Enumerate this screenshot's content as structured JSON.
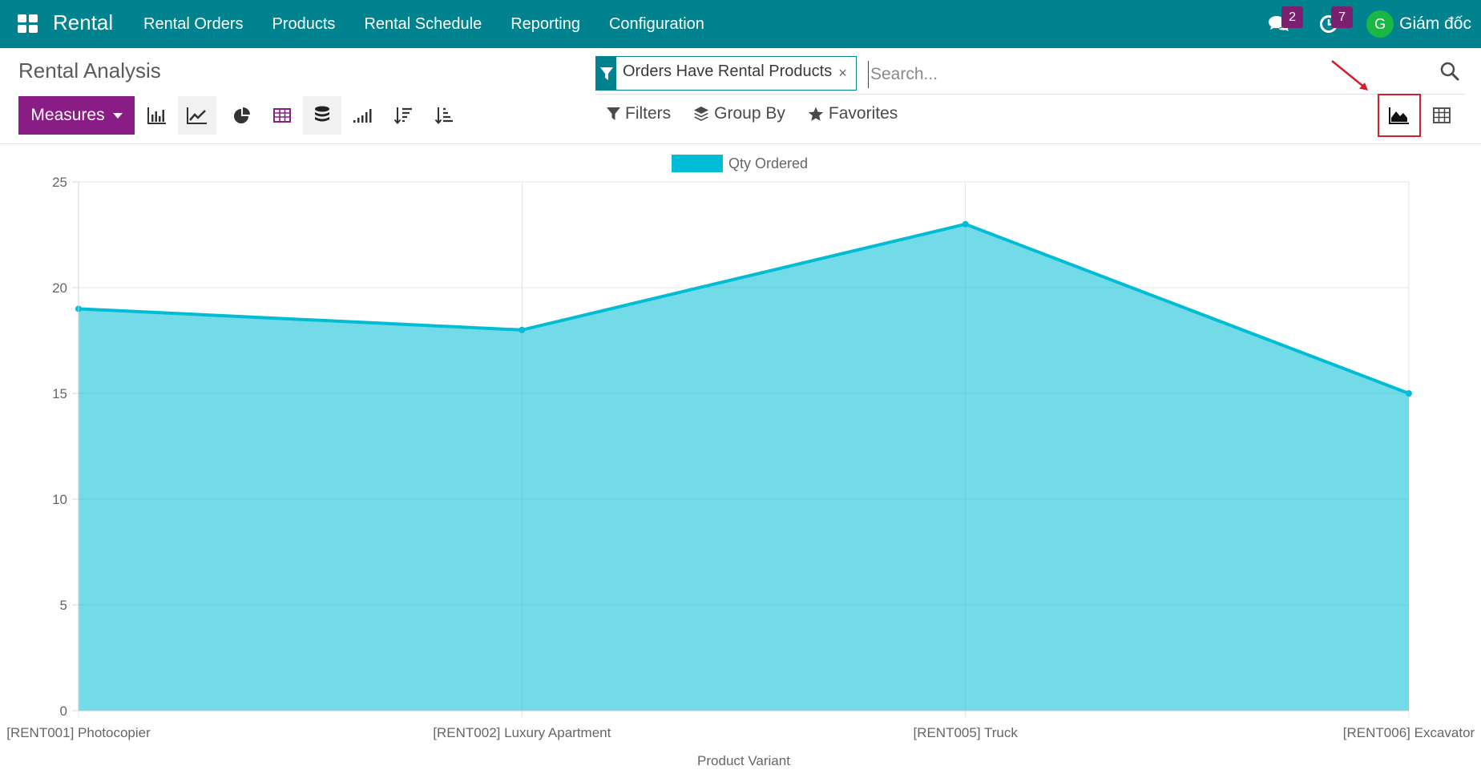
{
  "navbar": {
    "brand": "Rental",
    "menu": [
      "Rental Orders",
      "Products",
      "Rental Schedule",
      "Reporting",
      "Configuration"
    ],
    "messages_count": "2",
    "activities_count": "7",
    "user_initial": "G",
    "user_name": "Giám đốc",
    "bg_color": "#00838f"
  },
  "control_panel": {
    "title": "Rental Analysis",
    "facet_value": "Orders Have Rental Products",
    "facet_remove": "×",
    "search_placeholder": "Search...",
    "measures_label": "Measures",
    "filters_label": "Filters",
    "groupby_label": "Group By",
    "favorites_label": "Favorites",
    "chart_tools": [
      "bar-chart-icon",
      "line-chart-icon",
      "pie-chart-icon",
      "table-icon",
      "stacked-icon",
      "cumulative-icon",
      "sort-descending-icon",
      "sort-ascending-icon"
    ],
    "views": [
      "graph-view-icon",
      "pivot-view-icon"
    ],
    "accent_color": "#8a1c86"
  },
  "chart_data": {
    "type": "area",
    "categories": [
      "[RENT001] Photocopier",
      "[RENT002] Luxury Apartment",
      "[RENT005] Truck",
      "[RENT006] Excavator"
    ],
    "series": [
      {
        "name": "Qty Ordered",
        "values": [
          19,
          18,
          23,
          15
        ],
        "color": "#00bcd4"
      }
    ],
    "xlabel": "Product Variant",
    "ylabel": "",
    "ylim": [
      0,
      25
    ],
    "yticks": [
      0,
      5,
      10,
      15,
      20,
      25
    ],
    "grid": true,
    "legend": "top-center"
  }
}
